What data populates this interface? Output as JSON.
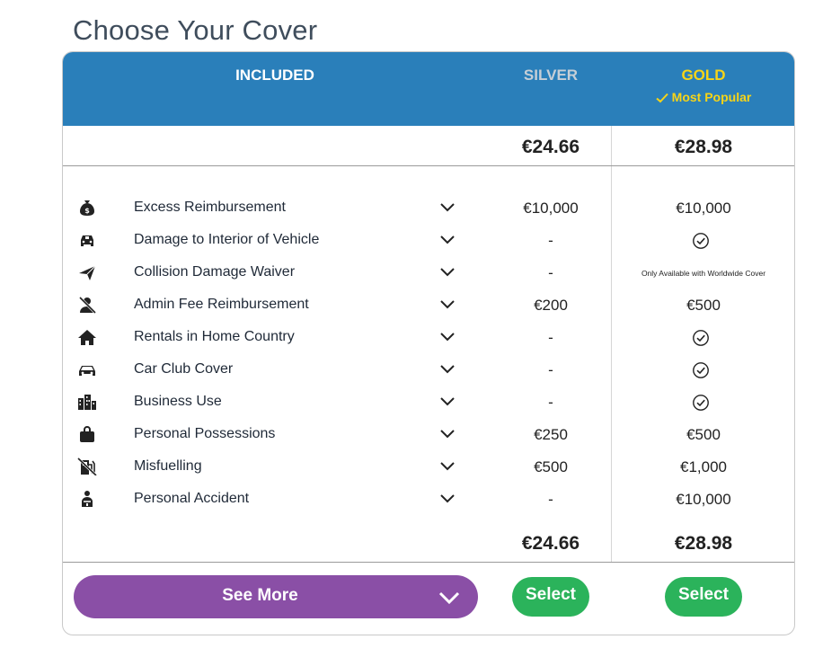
{
  "page": {
    "title": "Choose Your Cover"
  },
  "header": {
    "included_label": "INCLUDED",
    "silver_label": "SILVER",
    "gold_label": "GOLD",
    "gold_badge": "Most Popular",
    "check_icon": "check-icon"
  },
  "prices": {
    "silver": "€24.66",
    "gold": "€28.98"
  },
  "rows": [
    {
      "icon": "money-bag-icon",
      "label": "Excess Reimbursement",
      "silver": "€10,000",
      "gold": "€10,000"
    },
    {
      "icon": "car-interior-icon",
      "label": "Damage to Interior of Vehicle",
      "silver": "-",
      "gold": "check"
    },
    {
      "icon": "plane-icon",
      "label": "Collision Damage Waiver",
      "silver": "-",
      "gold": "Only Available with Worldwide Cover"
    },
    {
      "icon": "person-slash-icon",
      "label": "Admin Fee Reimbursement",
      "silver": "€200",
      "gold": "€500"
    },
    {
      "icon": "home-icon",
      "label": "Rentals in Home Country",
      "silver": "-",
      "gold": "check"
    },
    {
      "icon": "car-icon",
      "label": "Car Club Cover",
      "silver": "-",
      "gold": "check"
    },
    {
      "icon": "buildings-icon",
      "label": "Business Use",
      "silver": "-",
      "gold": "check"
    },
    {
      "icon": "bag-icon",
      "label": "Personal Possessions",
      "silver": "€250",
      "gold": "€500"
    },
    {
      "icon": "fuel-pump-slash-icon",
      "label": "Misfuelling",
      "silver": "€500",
      "gold": "€1,000"
    },
    {
      "icon": "injured-person-icon",
      "label": "Personal Accident",
      "silver": "-",
      "gold": "€10,000"
    }
  ],
  "footer": {
    "see_more_label": "See More",
    "silver_select_label": "Select",
    "gold_select_label": "Select"
  },
  "colors": {
    "header_bg": "#2a7fba",
    "gold": "#f7d417",
    "silver": "#c6cfd7",
    "see_more_bg": "#8a4fa6",
    "select_bg": "#2bb35b"
  }
}
